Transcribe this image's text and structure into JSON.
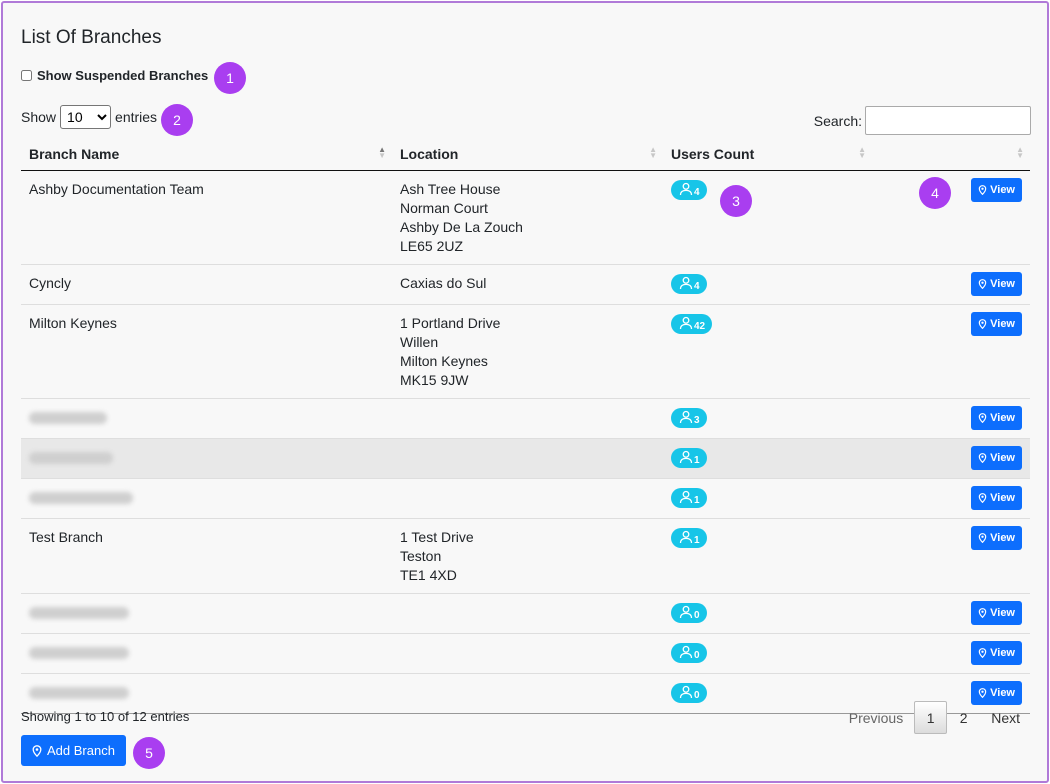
{
  "page_title": "List Of Branches",
  "suspended_label": "Show Suspended Branches",
  "length": {
    "show_label": "Show",
    "selected": "10",
    "entries_label": "entries"
  },
  "search": {
    "label": "Search:"
  },
  "columns": [
    "Branch Name",
    "Location",
    "Users Count",
    ""
  ],
  "view_label": "View",
  "rows": [
    {
      "name": "Ashby Documentation Team",
      "location": [
        "Ash Tree House",
        "Norman Court",
        "Ashby De La Zouch",
        "LE65 2UZ"
      ],
      "users": "4"
    },
    {
      "name": "Cyncly",
      "location": [
        "Caxias do Sul"
      ],
      "users": "4"
    },
    {
      "name": "Milton Keynes",
      "location": [
        "1 Portland Drive",
        "Willen",
        "Milton Keynes",
        "MK15 9JW"
      ],
      "users": "42"
    },
    {
      "name": "",
      "location": [],
      "users": "3"
    },
    {
      "name": "",
      "location": [],
      "users": "1"
    },
    {
      "name": "",
      "location": [],
      "users": "1"
    },
    {
      "name": "Test Branch",
      "location": [
        "1 Test Drive",
        "Teston",
        "TE1 4XD"
      ],
      "users": "1"
    },
    {
      "name": "",
      "location": [],
      "users": "0"
    },
    {
      "name": "",
      "location": [],
      "users": "0"
    },
    {
      "name": "",
      "location": [],
      "users": "0"
    }
  ],
  "info": "Showing 1 to 10 of 12 entries",
  "pagination": {
    "previous": "Previous",
    "pages": [
      "1",
      "2"
    ],
    "current": "1",
    "next": "Next"
  },
  "add_button": "Add Branch",
  "markers": [
    "1",
    "2",
    "3",
    "4",
    "5"
  ],
  "colors": {
    "primary": "#0d6efd",
    "badge": "#17c5e8",
    "marker": "#a93ef0",
    "frame": "#b07ad8"
  }
}
